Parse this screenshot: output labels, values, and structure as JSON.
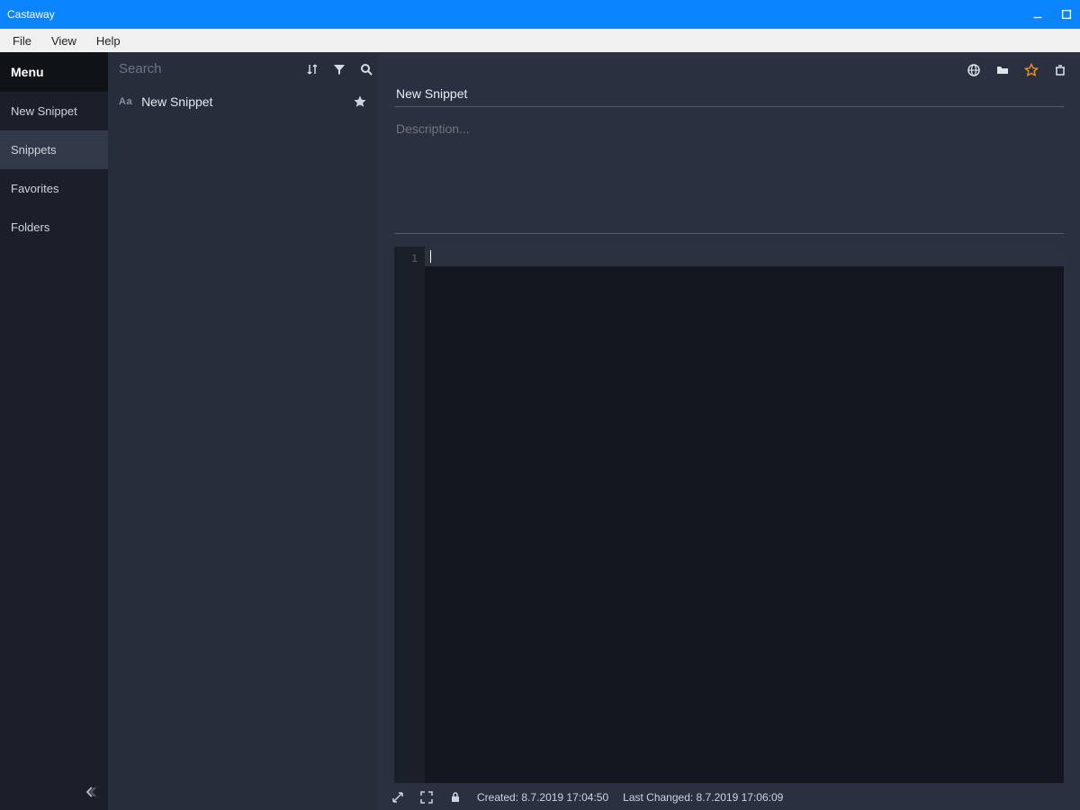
{
  "window": {
    "title": "Castaway"
  },
  "menu": {
    "file": "File",
    "view": "View",
    "help": "Help"
  },
  "sidebar": {
    "header": "Menu",
    "items": [
      {
        "label": "New Snippet"
      },
      {
        "label": "Snippets"
      },
      {
        "label": "Favorites"
      },
      {
        "label": "Folders"
      }
    ]
  },
  "search": {
    "placeholder": "Search"
  },
  "snippet_list": {
    "items": [
      {
        "icon": "Aa",
        "label": "New Snippet"
      }
    ]
  },
  "editor": {
    "title_value": "New Snippet",
    "description_placeholder": "Description...",
    "gutter_first_line": "1"
  },
  "statusbar": {
    "created_label": "Created:",
    "created_value": "8.7.2019 17:04:50",
    "changed_label": "Last Changed:",
    "changed_value": "8.7.2019 17:06:09"
  }
}
